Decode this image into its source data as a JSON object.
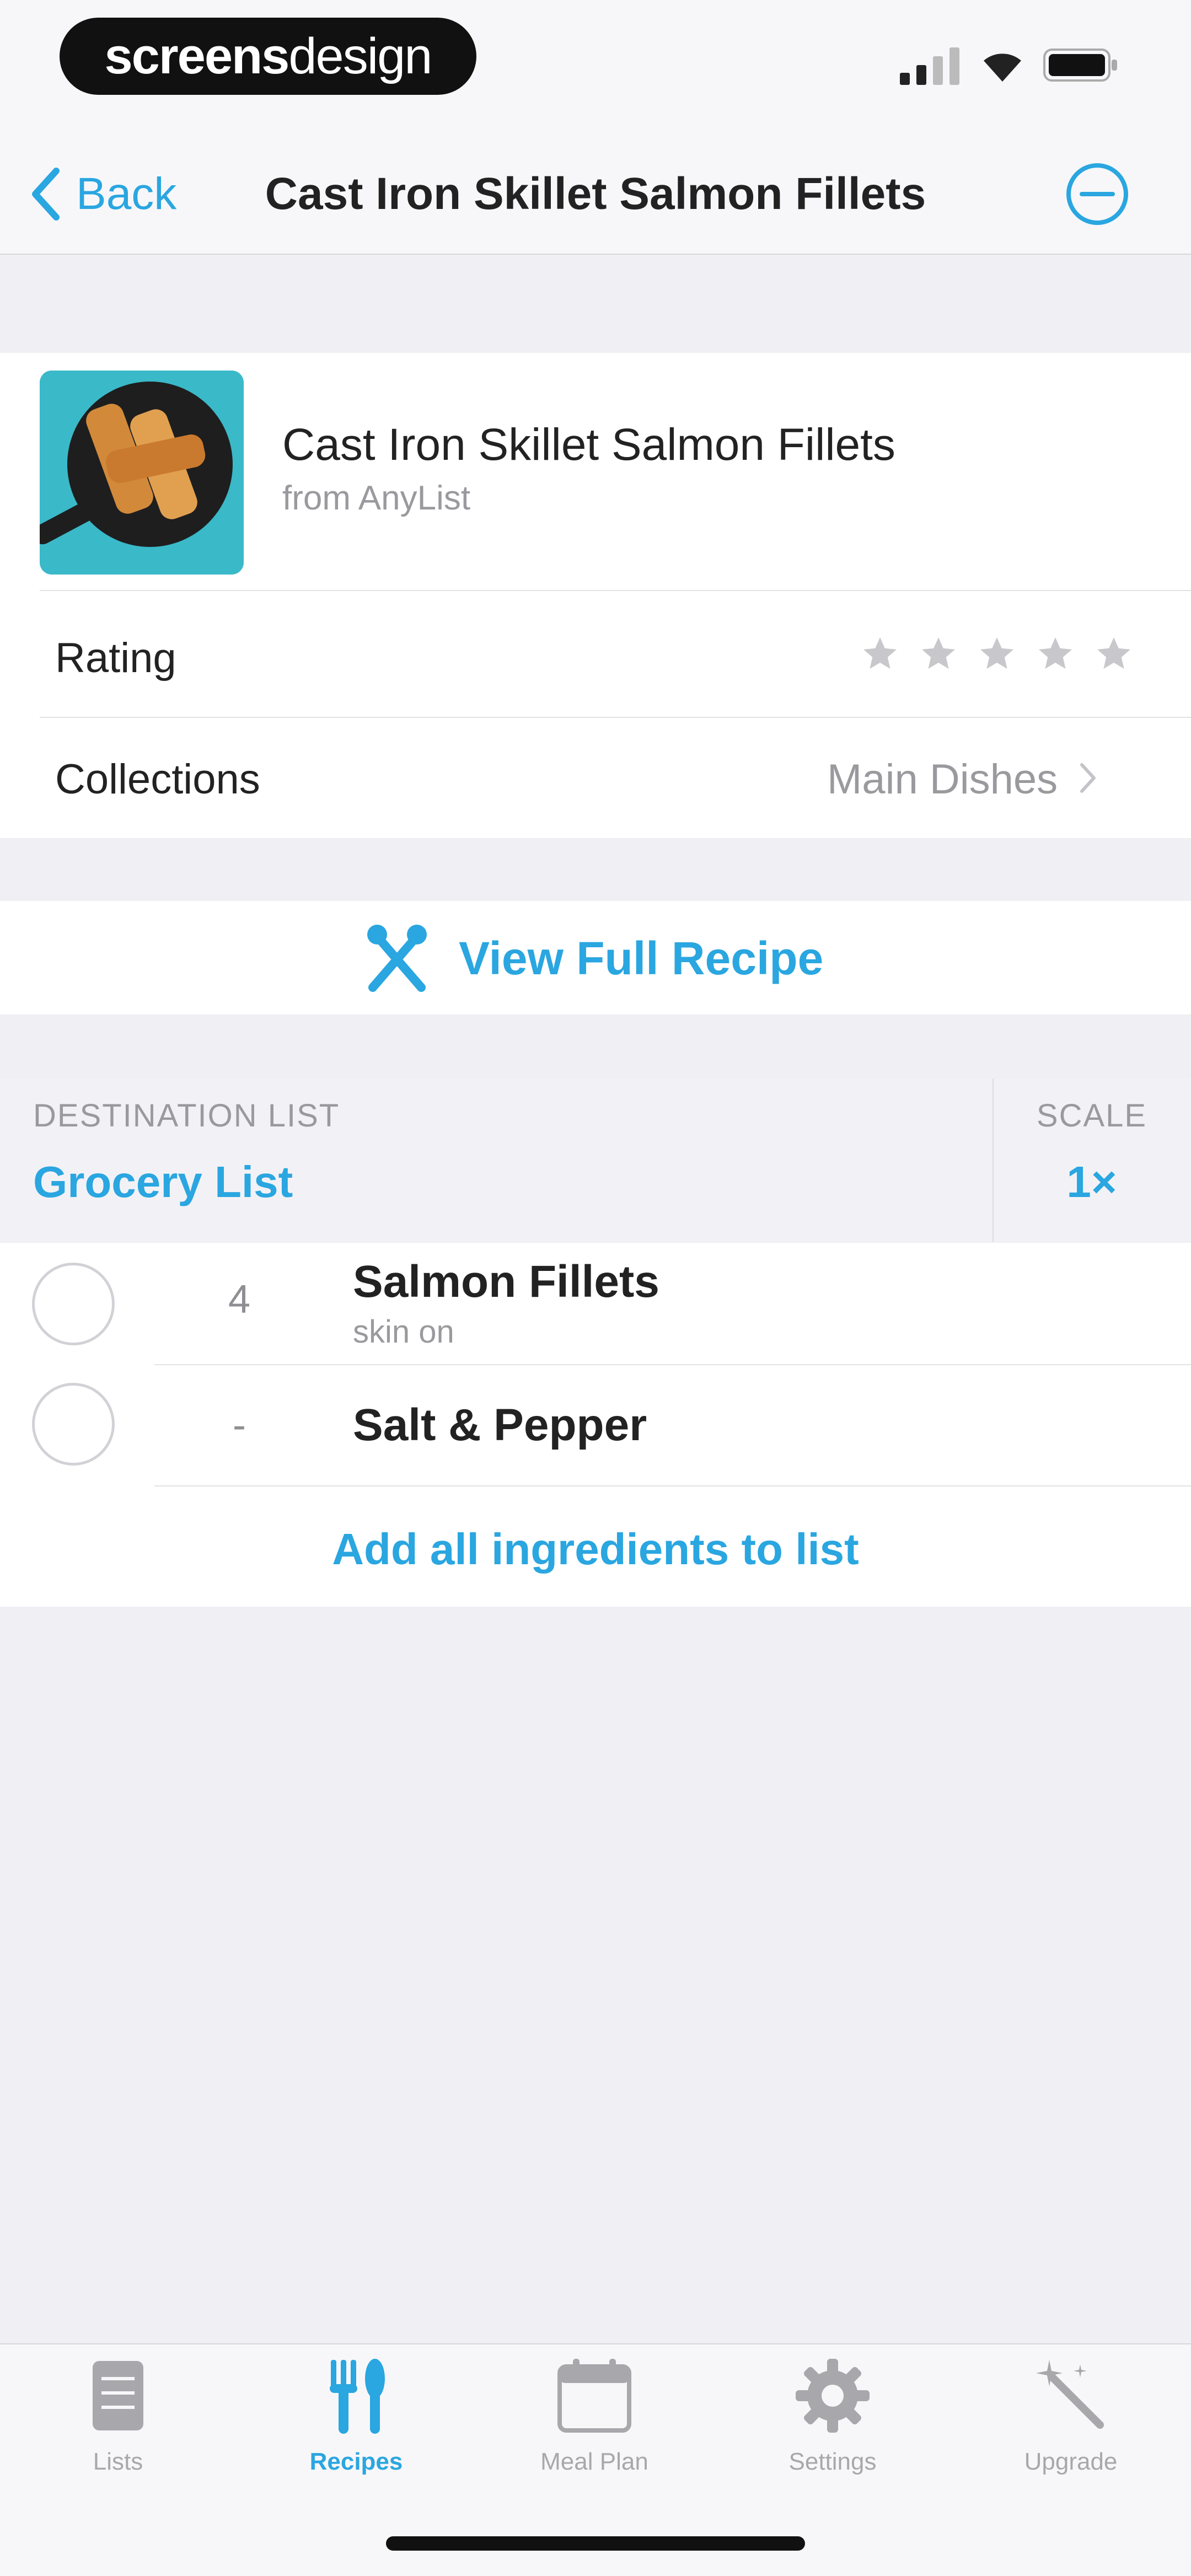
{
  "watermark": {
    "bold": "screens",
    "light": "design"
  },
  "nav": {
    "back_label": "Back",
    "title": "Cast Iron Skillet Salmon Fillets"
  },
  "recipe": {
    "name": "Cast Iron Skillet Salmon Fillets",
    "source": "from AnyList",
    "rating_label": "Rating",
    "rating_value": 0,
    "rating_max": 5,
    "collections_label": "Collections",
    "collections_value": "Main Dishes"
  },
  "view_full_recipe": "View Full Recipe",
  "destination": {
    "label": "DESTINATION LIST",
    "value": "Grocery List",
    "scale_label": "SCALE",
    "scale_value": "1×"
  },
  "ingredients": [
    {
      "qty": "4",
      "name": "Salmon Fillets",
      "note": "skin on"
    },
    {
      "qty": "-",
      "name": "Salt & Pepper",
      "note": ""
    }
  ],
  "add_all_label": "Add all ingredients to list",
  "tabs": [
    {
      "label": "Lists",
      "icon": "lists-icon",
      "active": false
    },
    {
      "label": "Recipes",
      "icon": "recipes-icon",
      "active": true
    },
    {
      "label": "Meal Plan",
      "icon": "meal-plan-icon",
      "active": false
    },
    {
      "label": "Settings",
      "icon": "settings-icon",
      "active": false
    },
    {
      "label": "Upgrade",
      "icon": "upgrade-icon",
      "active": false
    }
  ],
  "colors": {
    "accent": "#2aa6e0",
    "background": "#efeff4",
    "text": "#222222",
    "secondary_text": "#9a9a9e"
  }
}
